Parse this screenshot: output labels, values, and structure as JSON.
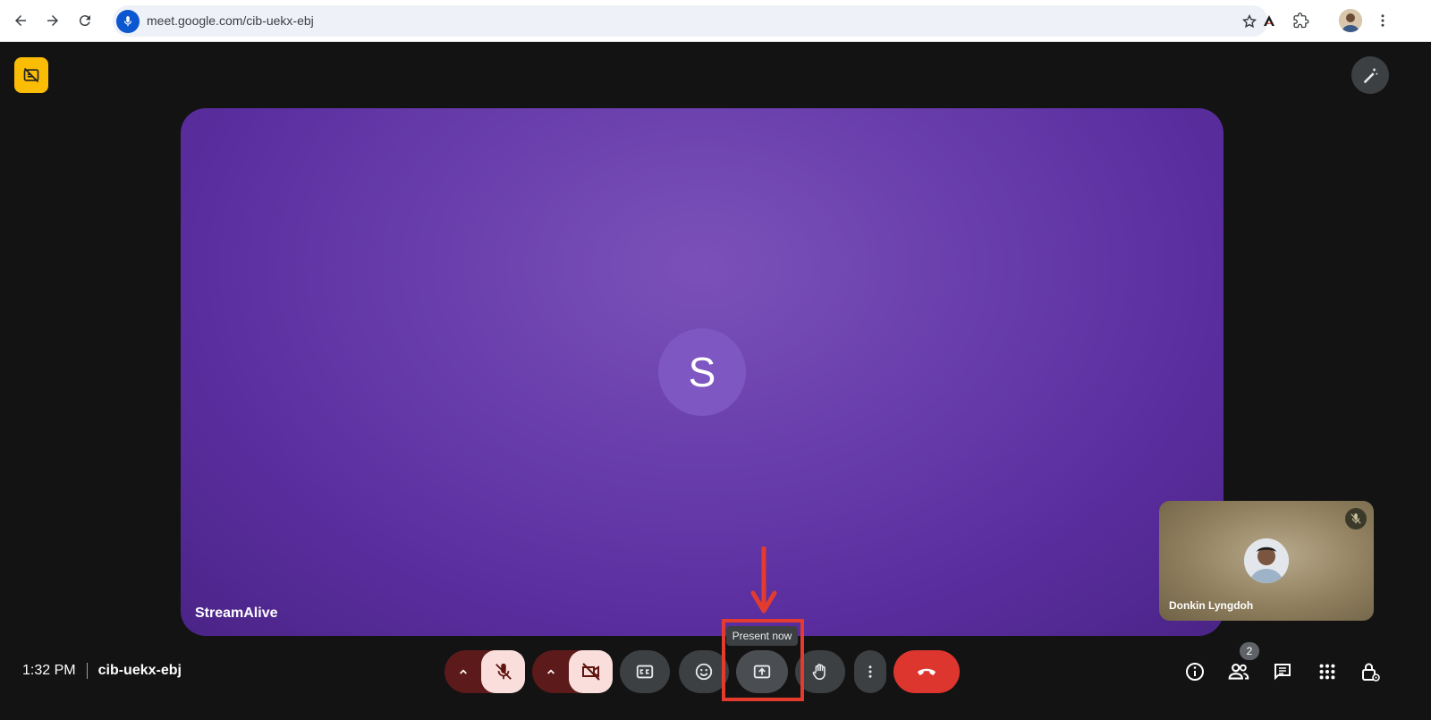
{
  "browser": {
    "url": "meet.google.com/cib-uekx-ebj",
    "icons": [
      "back-arrow-icon",
      "forward-arrow-icon",
      "reload-icon",
      "microphone-icon",
      "star-icon",
      "extension-a-icon",
      "puzzle-icon",
      "profile-avatar",
      "kebab-menu-icon"
    ]
  },
  "meet": {
    "main_tile": {
      "participant_initial": "S",
      "participant_name": "StreamAlive",
      "background_color": "#6a3fad"
    },
    "self_view": {
      "name": "Donkin Lyngdoh",
      "mic_state": "muted"
    },
    "bottom_bar": {
      "time": "1:32 PM",
      "meeting_code": "cib-uekx-ebj",
      "tooltip": "Present now",
      "participant_count": "2",
      "controls": [
        "audio-options",
        "mic-off",
        "video-options",
        "camera-off",
        "captions",
        "emoji-reactions",
        "present-now",
        "raise-hand",
        "more-options",
        "leave-call"
      ],
      "right_controls": [
        "meeting-details",
        "people",
        "chat",
        "activities",
        "host-controls"
      ]
    },
    "colors": {
      "accent_red": "#dc362e",
      "annotation_red": "#e33b2e",
      "badge_yellow": "#fbbc04",
      "muted_toggle_bg": "#f9dedc"
    }
  }
}
